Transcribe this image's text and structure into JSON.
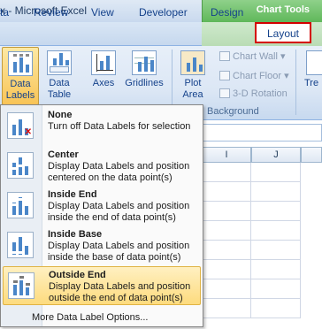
{
  "window": {
    "title": "x - Microsoft Excel"
  },
  "contextual": {
    "label": "Chart Tools"
  },
  "tabs": [
    "ta",
    "Review",
    "View",
    "Developer",
    "Design",
    "Layout"
  ],
  "ribbon": {
    "data_labels": "Data Labels",
    "data_table": "Data Table",
    "axes": "Axes",
    "gridlines": "Gridlines",
    "plot_area": "Plot Area",
    "chart_wall": "Chart Wall",
    "chart_floor": "Chart Floor",
    "rotation_3d": "3-D Rotation",
    "background_group": "Background",
    "trendline_partial": "Tre"
  },
  "sheet": {
    "columns": [
      "I",
      "J"
    ]
  },
  "menu": {
    "items": [
      {
        "title": "None",
        "desc": "Turn off Data Labels for selection",
        "icon": "no-labels-icon",
        "selected": false
      },
      {
        "title": "Center",
        "desc": "Display Data Labels and position centered on the data point(s)",
        "icon": "center-labels-icon",
        "selected": false
      },
      {
        "title": "Inside End",
        "desc": "Display Data Labels and position inside the end of data point(s)",
        "icon": "inside-end-labels-icon",
        "selected": false
      },
      {
        "title": "Inside Base",
        "desc": "Display Data Labels and position inside the base of data point(s)",
        "icon": "inside-base-labels-icon",
        "selected": false
      },
      {
        "title": "Outside End",
        "desc": "Display Data Labels and position outside the end of data point(s)",
        "icon": "outside-end-labels-icon",
        "selected": true
      }
    ],
    "more": "More Data Label Options..."
  },
  "colors": {
    "accent": "#15428b",
    "highlight": "#fddb7e",
    "layout_outline": "#d40000"
  }
}
